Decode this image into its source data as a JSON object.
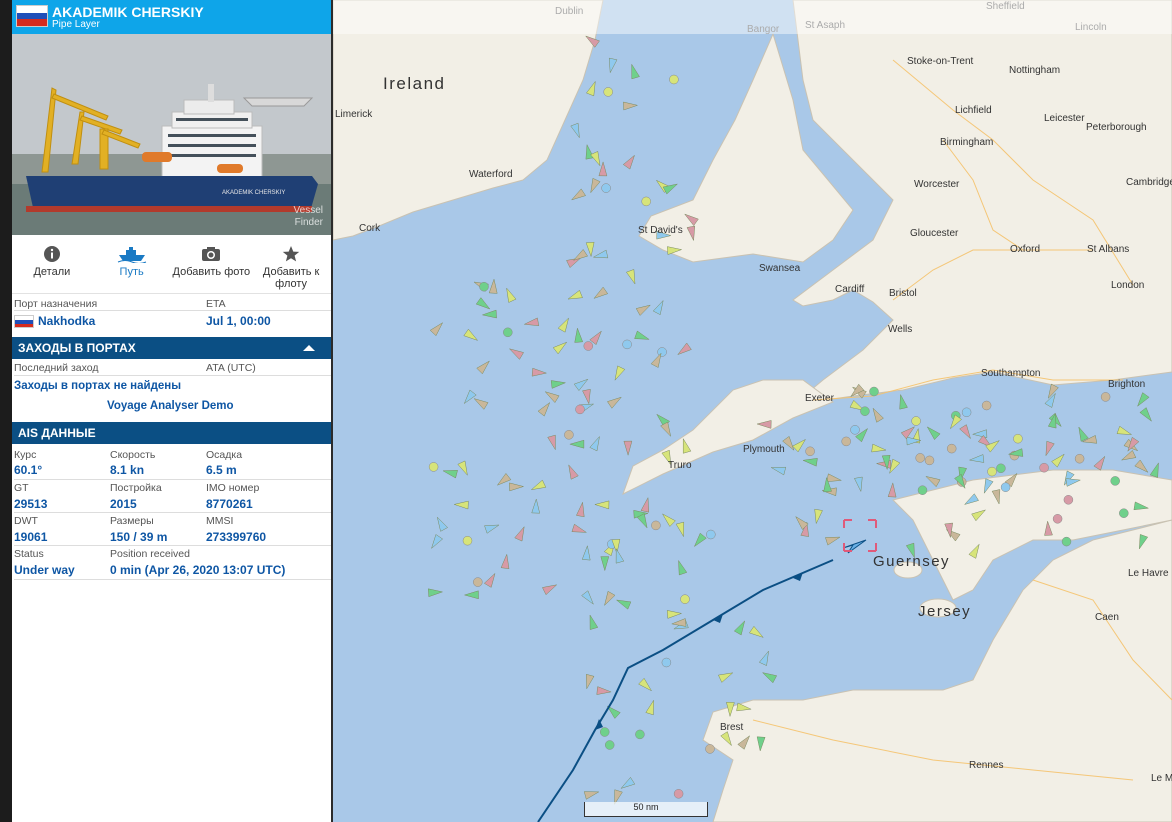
{
  "vessel": {
    "name": "AKADEMIK CHERSKIY",
    "type": "Pipe Layer",
    "flag_colors": [
      "#ffffff",
      "#1f4fb8",
      "#d52b1e"
    ],
    "photo_watermark_1": "Vessel",
    "photo_watermark_2": "Finder"
  },
  "actions": [
    {
      "label": "Детали",
      "icon": "info-icon"
    },
    {
      "label": "Путь",
      "icon": "ship-route-icon"
    },
    {
      "label": "Добавить фото",
      "icon": "camera-icon"
    },
    {
      "label": "Добавить к флоту",
      "icon": "star-icon"
    }
  ],
  "destination": {
    "port_label": "Порт назначения",
    "eta_label": "ETA",
    "port": "Nakhodka",
    "eta": "Jul 1, 00:00"
  },
  "port_calls": {
    "title": "ЗАХОДЫ В ПОРТАХ",
    "last_label": "Последний заход",
    "ata_label": "ATA (UTC)",
    "empty_text": "Заходы в портах не найдены",
    "analyser_link": "Voyage Analyser Demo"
  },
  "ais": {
    "title": "AIS ДАННЫЕ",
    "course_label": "Курс",
    "course": "60.1°",
    "speed_label": "Скорость",
    "speed": "8.1 kn",
    "draught_label": "Осадка",
    "draught": "6.5 m",
    "gt_label": "GT",
    "gt": "29513",
    "built_label": "Постройка",
    "built": "2015",
    "imo_label": "IMO номер",
    "imo": "8770261",
    "dwt_label": "DWT",
    "dwt": "19061",
    "size_label": "Размеры",
    "size": "150 / 39 m",
    "mmsi_label": "MMSI",
    "mmsi": "273399760",
    "status_label": "Status",
    "status": "Under way",
    "position_label": "Position received",
    "position": "0 min (Apr 26, 2020 13:07 UTC)"
  },
  "map": {
    "scale_label": "50 nm",
    "colors": {
      "sea": "#a9c8e8",
      "land": "#f2efe6",
      "route": "#0b4f84",
      "selection": "#e05a7a"
    },
    "places": {
      "dublin": "Dublin",
      "sheffield": "Sheffield",
      "bangor": "Bangor",
      "st_asaph": "St Asaph",
      "lincoln": "Lincoln",
      "ireland": "Ireland",
      "limerick": "Limerick",
      "stoke": "Stoke-on-Trent",
      "nottingham": "Nottingham",
      "lichfield": "Lichfield",
      "leicester": "Leicester",
      "birmingham": "Birmingham",
      "peterborough": "Peterborough",
      "waterford": "Waterford",
      "worcester": "Worcester",
      "cambridge": "Cambridge",
      "cork": "Cork",
      "st_davids": "St David's",
      "gloucester": "Gloucester",
      "oxford": "Oxford",
      "st_albans": "St Albans",
      "swansea": "Swansea",
      "cardiff": "Cardiff",
      "bristol": "Bristol",
      "london": "London",
      "wells": "Wells",
      "southampton": "Southampton",
      "brighton": "Brighton",
      "exeter": "Exeter",
      "plymouth": "Plymouth",
      "truro": "Truro",
      "guernsey": "Guernsey",
      "jersey": "Jersey",
      "le_havre": "Le Havre",
      "caen": "Caen",
      "brest": "Brest",
      "rennes": "Rennes",
      "le_mans": "Le Mans"
    }
  }
}
